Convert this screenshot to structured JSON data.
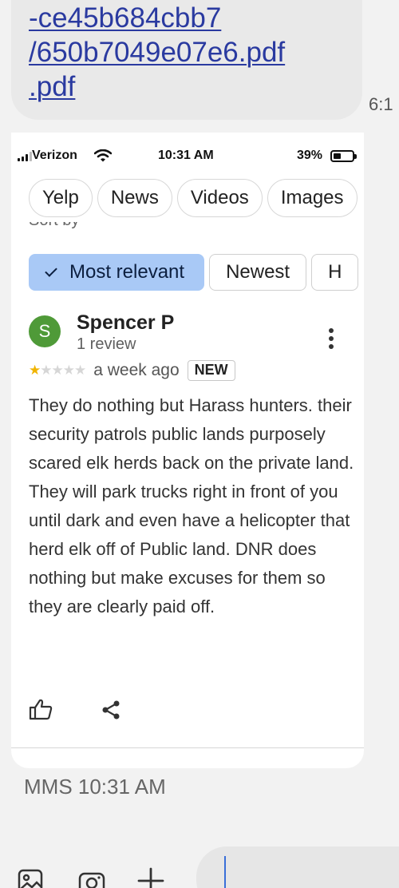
{
  "message": {
    "link_lines": [
      "-ce45b684cbb7",
      "/650b7049e07e6.pdf",
      ".pdf"
    ],
    "side_time": "6:1",
    "mms_label": "MMS 10:31 AM"
  },
  "screenshot": {
    "status_bar": {
      "carrier": "Verizon",
      "time": "10:31 AM",
      "battery": "39%"
    },
    "chips": [
      "Yelp",
      "News",
      "Videos",
      "Images"
    ],
    "partial_label": "Sort by",
    "sort_options": [
      "Most relevant",
      "Newest",
      "H"
    ],
    "review": {
      "avatar_letter": "S",
      "name": "Spencer P",
      "review_count": "1 review",
      "rating": 1,
      "rating_max": 5,
      "time_ago": "a week ago",
      "badge": "NEW",
      "text": "They do nothing but Harass hunters. their security patrols public lands purposely scared elk herds back on the private land. They will park trucks right in front of you until dark and even have a helicopter that herd elk off of Public land. DNR does nothing but make excuses for them so they are clearly paid off."
    }
  },
  "colors": {
    "link": "#2a3aa0",
    "active_sort_bg": "#a9c9f6",
    "avatar_bg": "#4f9a38",
    "star": "#f0b400"
  }
}
